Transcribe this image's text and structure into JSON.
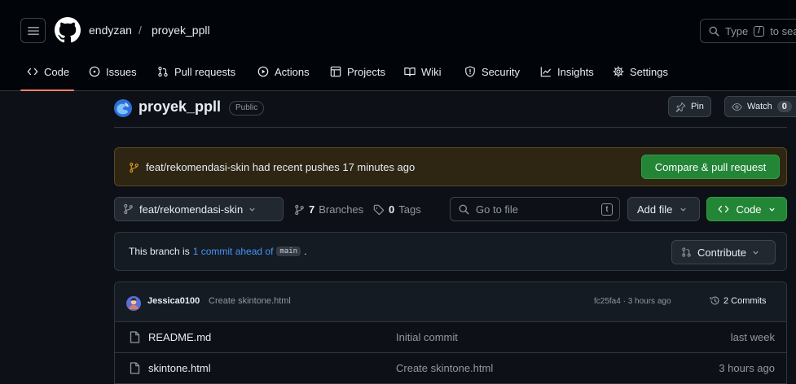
{
  "header": {
    "owner": "endyzan",
    "separator": "/",
    "repo": "proyek_ppll",
    "search_prefix": "Type",
    "search_key": "/",
    "search_suffix": "to sea"
  },
  "nav": {
    "code": "Code",
    "issues": "Issues",
    "pull_requests": "Pull requests",
    "actions": "Actions",
    "projects": "Projects",
    "wiki": "Wiki",
    "security": "Security",
    "insights": "Insights",
    "settings": "Settings"
  },
  "repo": {
    "name": "proyek_ppll",
    "visibility": "Public",
    "pin_label": "Pin",
    "watch_label": "Watch",
    "watch_count": "0"
  },
  "banner": {
    "text": "feat/rekomendasi-skin had recent pushes 17 minutes ago",
    "button": "Compare & pull request"
  },
  "branch_bar": {
    "branch": "feat/rekomendasi-skin",
    "branches_count": "7",
    "branches_label": "Branches",
    "tags_count": "0",
    "tags_label": "Tags",
    "goto_placeholder": "Go to file",
    "goto_key": "t",
    "add_file": "Add file",
    "code_button": "Code"
  },
  "ahead": {
    "prefix": "This branch is",
    "link": "1 commit ahead of",
    "base": "main",
    "suffix": ".",
    "contribute": "Contribute"
  },
  "latest_commit": {
    "author": "Jessica0100",
    "message": "Create skintone.html",
    "meta": "fc25fa4 · 3 hours ago",
    "commits_label": "2 Commits"
  },
  "files": [
    {
      "name": "README.md",
      "commit": "Initial commit",
      "time": "last week"
    },
    {
      "name": "skintone.html",
      "commit": "Create skintone.html",
      "time": "3 hours ago"
    }
  ],
  "colors": {
    "accent_green": "#238636",
    "link_blue": "#4493f8",
    "tab_underline": "#f78166",
    "banner_bg": "#2e2513",
    "branch_icon": "#d29922"
  }
}
